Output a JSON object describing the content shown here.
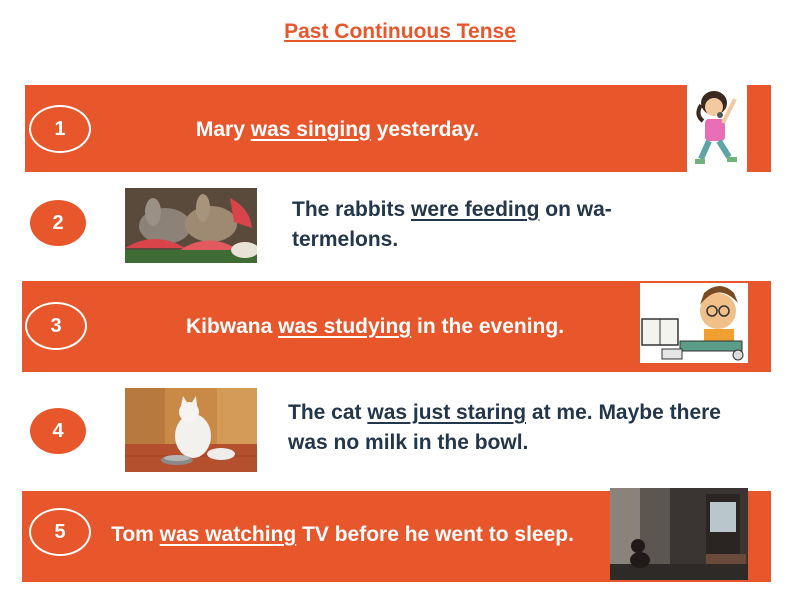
{
  "title": "Past Continuous Tense",
  "items": [
    {
      "number": "1",
      "pre": "Mary ",
      "verb": "was singing",
      "post": " yesterday."
    },
    {
      "number": "2",
      "pre": "The rabbits ",
      "verb": "were feeding",
      "post": " on wa-termelons."
    },
    {
      "number": "3",
      "pre": "Kibwana ",
      "verb": "was studying",
      "post": " in the evening."
    },
    {
      "number": "4",
      "pre": "The cat ",
      "verb": "was just staring",
      "post": " at me. Maybe there was no milk in the bowl."
    },
    {
      "number": "5",
      "pre": "Tom ",
      "verb": "was watching",
      "post": " TV before he went to sleep."
    }
  ],
  "colors": {
    "accent": "#e8572c",
    "text_dark": "#24364a",
    "white": "#ffffff"
  },
  "images": [
    "girl-singing-illustration",
    "rabbits-eating-watermelon-photo",
    "boy-studying-illustration",
    "white-cat-with-bowl-photo",
    "child-watching-tv-photo"
  ]
}
